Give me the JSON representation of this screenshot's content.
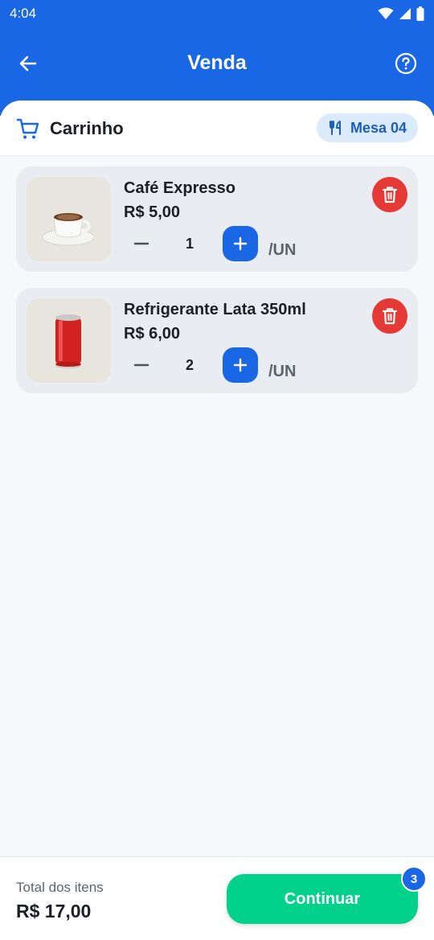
{
  "status_bar": {
    "time": "4:04"
  },
  "app_bar": {
    "title": "Venda"
  },
  "cart": {
    "title": "Carrinho",
    "table_label": "Mesa 04",
    "items": [
      {
        "name": "Café Expresso",
        "price": "R$ 5,00",
        "quantity": "1",
        "unit": "/UN",
        "image": "espresso-cup"
      },
      {
        "name": "Refrigerante Lata 350ml",
        "price": "R$ 6,00",
        "quantity": "2",
        "unit": "/UN",
        "image": "red-soda-can"
      }
    ]
  },
  "footer": {
    "total_label": "Total dos itens",
    "total_value": "R$ 17,00",
    "continue_label": "Continuar",
    "badge_count": "3"
  },
  "colors": {
    "primary": "#1a67e6",
    "success": "#00d18b",
    "danger": "#e53935",
    "chip_bg": "#dbeafc"
  }
}
